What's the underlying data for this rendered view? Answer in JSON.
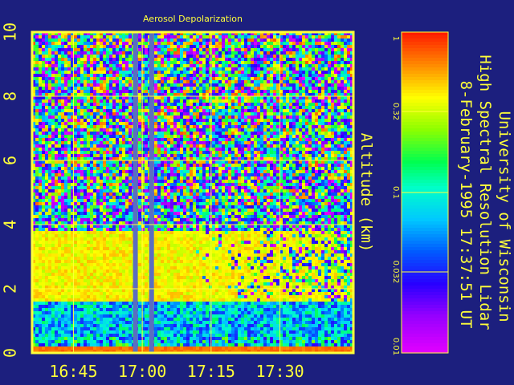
{
  "chart_data": {
    "type": "heatmap",
    "title": "Aerosol Depolarization",
    "header_lines": [
      "University of Wisconsin",
      "High Spectral Resolution Lidar",
      "8-February-1995 17:37:51 UT"
    ],
    "ylabel": "Altitude (km)",
    "xlabel": "",
    "x_ticks": [
      "16:45",
      "17:00",
      "17:15",
      "17:30"
    ],
    "x_tick_values_min": [
      1005,
      1020,
      1035,
      1050
    ],
    "x_range_min": [
      996,
      1066
    ],
    "y_ticks": [
      "0",
      "2",
      "4",
      "6",
      "8",
      "10"
    ],
    "y_tick_values": [
      0,
      2,
      4,
      6,
      8,
      10
    ],
    "ylim": [
      0,
      10
    ],
    "grid": true,
    "colorbar": {
      "scale": "log",
      "range": [
        0.01,
        1
      ],
      "tick_labels": [
        "1",
        "0.32",
        "0.1",
        "0.032",
        "0.01"
      ],
      "tick_values": [
        1,
        0.32,
        0.1,
        0.032,
        0.01
      ]
    },
    "cloud_layer": {
      "altitude_range_km": [
        0.6,
        4.0
      ],
      "dense_core_altitude_km": [
        1.6,
        3.9
      ]
    },
    "data_gaps_min": [
      1018.5,
      1019.4
    ],
    "colors": {
      "background": "#1c1f7e",
      "frame": "#ffff3a",
      "text": "#ffff3a",
      "gap_bar": "#5b6ec0"
    }
  }
}
